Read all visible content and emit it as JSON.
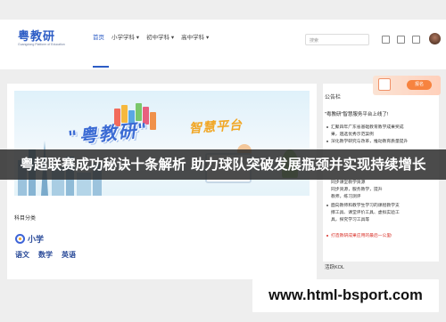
{
  "app": {
    "logo": "粤教研",
    "logo_sub": "Guangdong Platform of Education"
  },
  "nav": {
    "items": [
      "首页",
      "小学学科",
      "初中学科",
      "高中学科"
    ],
    "active_index": 0
  },
  "search": {
    "placeholder": "搜索"
  },
  "banner": {
    "title_main": "\"粤教研\"",
    "title_secondary": "智慧平台"
  },
  "category": {
    "label": "科目分类",
    "level": "小学",
    "subjects": [
      "语文",
      "数学",
      "英语"
    ]
  },
  "sidebar": {
    "title": "公告栏",
    "promo_button": "报名",
    "welcome": "\"粤教研\"智慧服务平台上线了!",
    "bullets": [
      "汇聚四年广东省基础教育教学成果奖成",
      "果，遴选优秀示范案例",
      "深化教学研究与改革，推动教育质量提升",
      "同步课堂教学资源",
      "同步资源，服务教学，提升",
      "教师，练习测评",
      "面向教师和教学生学习的课程教学支",
      "撑工具、课堂评价工具、虚拟实验工",
      "具，探究学习工具等"
    ],
    "highlight": "打造教研成果应用的最后一公里!",
    "sub_title": "活跃KOL"
  },
  "overlay": {
    "headline": "粤超联赛成功秘诀十条解析 助力球队突破发展瓶颈并实现持续增长",
    "watermark": "www.html-bsport.com"
  },
  "colors": {
    "brand": "#2c5cc5",
    "accent_orange": "#f7833f",
    "highlight_red": "#d9322a"
  }
}
